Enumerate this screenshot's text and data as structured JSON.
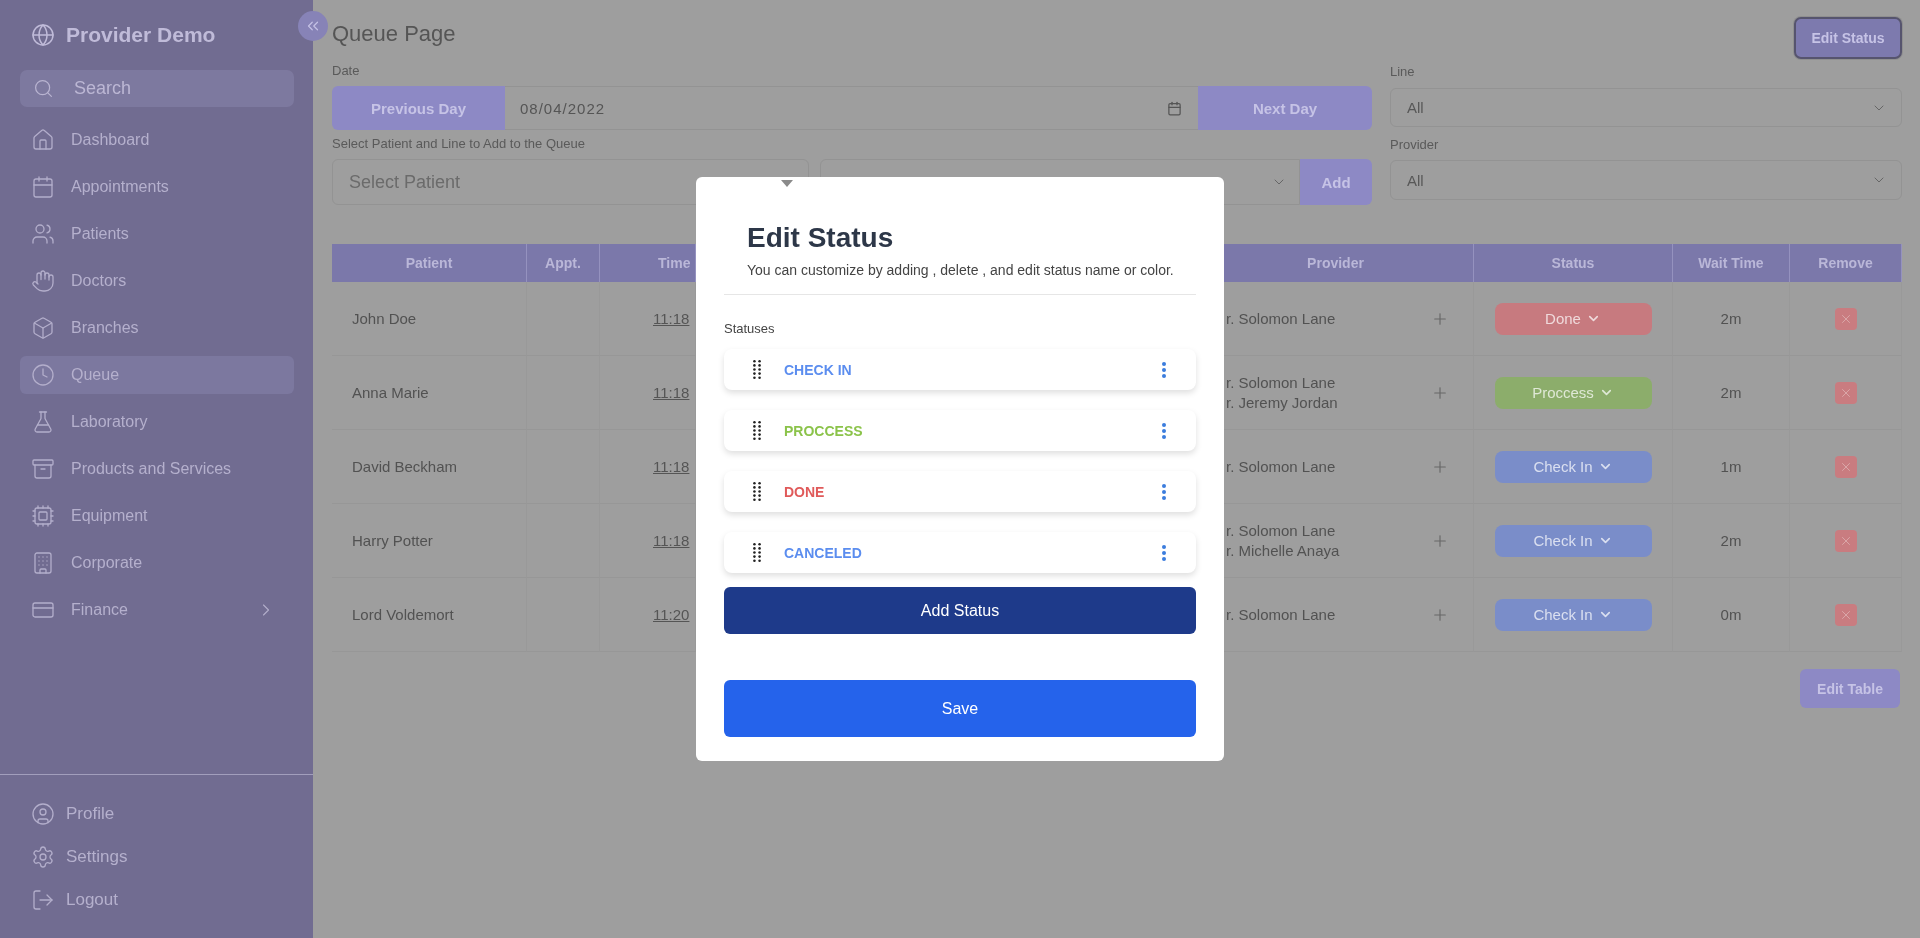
{
  "sidebar": {
    "brand": "Provider Demo",
    "search_placeholder": "Search",
    "items": [
      {
        "label": "Dashboard",
        "selected": false,
        "expandable": false
      },
      {
        "label": "Appointments",
        "selected": false,
        "expandable": false
      },
      {
        "label": "Patients",
        "selected": false,
        "expandable": false
      },
      {
        "label": "Doctors",
        "selected": false,
        "expandable": false
      },
      {
        "label": "Branches",
        "selected": false,
        "expandable": false
      },
      {
        "label": "Queue",
        "selected": true,
        "expandable": false
      },
      {
        "label": "Laboratory",
        "selected": false,
        "expandable": false
      },
      {
        "label": "Products and Services",
        "selected": false,
        "expandable": false
      },
      {
        "label": "Equipment",
        "selected": false,
        "expandable": false
      },
      {
        "label": "Corporate",
        "selected": false,
        "expandable": false
      },
      {
        "label": "Finance",
        "selected": false,
        "expandable": true
      }
    ],
    "footer_items": [
      "Profile",
      "Settings",
      "Logout"
    ]
  },
  "page": {
    "title": "Queue Page",
    "edit_status_button": {
      "label": "Edit Status",
      "focused": true
    }
  },
  "filters": {
    "date_label": "Date",
    "previous_day": "Previous Day",
    "date_value": "08/04/2022",
    "next_day": "Next Day",
    "add_label": "Select Patient and Line to Add to the Queue",
    "patient_placeholder": "Select Patient",
    "add_button": "Add",
    "line_label": "Line",
    "line_value": "All",
    "provider_label": "Provider",
    "provider_value": "All"
  },
  "table": {
    "columns": [
      "Patient",
      "Appt.",
      "Time",
      "Provider",
      "Status",
      "Wait Time",
      "Remove"
    ],
    "rows": [
      {
        "patient": "John Doe",
        "time": "11:18",
        "providers": [
          "r. Solomon Lane"
        ],
        "status": {
          "label": "Done",
          "color": "#c77a7f"
        },
        "wait": "2m"
      },
      {
        "patient": "Anna Marie",
        "time": "11:18",
        "providers": [
          "r. Solomon Lane",
          "r. Jeremy Jordan"
        ],
        "status": {
          "label": "Proccess",
          "color": "#8cad6b"
        },
        "wait": "2m"
      },
      {
        "patient": "David Beckham",
        "time": "11:18",
        "providers": [
          "r. Solomon Lane"
        ],
        "status": {
          "label": "Check In",
          "color": "#7a8dc9"
        },
        "wait": "1m"
      },
      {
        "patient": "Harry Potter",
        "time": "11:18",
        "providers": [
          "r. Solomon Lane",
          "r. Michelle Anaya"
        ],
        "status": {
          "label": "Check In",
          "color": "#7a8dc9"
        },
        "wait": "2m"
      },
      {
        "patient": "Lord Voldemort",
        "time": "11:20",
        "providers": [
          "r. Solomon Lane"
        ],
        "status": {
          "label": "Check In",
          "color": "#7a8dc9"
        },
        "wait": "0m"
      }
    ]
  },
  "edit_table_button": "Edit Table",
  "modal": {
    "title": "Edit Status",
    "subtitle": "You can customize by adding , delete , and edit status name or color.",
    "list_label": "Statuses",
    "statuses": [
      {
        "label": "CHECK IN",
        "color": "#5b8def"
      },
      {
        "label": "PROCCESS",
        "color": "#8bc34a"
      },
      {
        "label": "DONE",
        "color": "#e05a5a"
      },
      {
        "label": "CANCELED",
        "color": "#5b8def"
      }
    ],
    "add_button": "Add Status",
    "save_button": "Save"
  }
}
